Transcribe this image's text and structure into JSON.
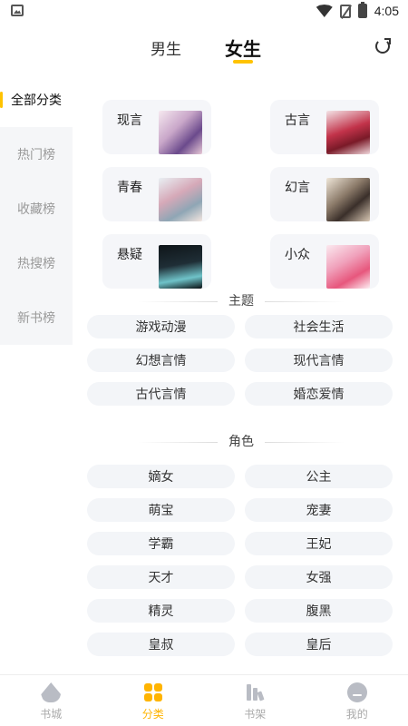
{
  "status_bar": {
    "time": "4:05",
    "icons": [
      "image-icon",
      "wifi-icon",
      "no-sim-icon",
      "battery-icon"
    ]
  },
  "header": {
    "tabs": [
      {
        "label": "男生"
      },
      {
        "label": "女生",
        "active": true
      }
    ],
    "accent_color": "#ffc300"
  },
  "sidebar": {
    "items": [
      {
        "label": "全部分类",
        "active": true
      },
      {
        "label": "热门榜"
      },
      {
        "label": "收藏榜"
      },
      {
        "label": "热搜榜"
      },
      {
        "label": "新书榜"
      }
    ]
  },
  "genres": [
    {
      "label": "现言"
    },
    {
      "label": "古言"
    },
    {
      "label": "青春"
    },
    {
      "label": "幻言"
    },
    {
      "label": "悬疑"
    },
    {
      "label": "小众"
    }
  ],
  "themes": {
    "title": "主题",
    "tags": [
      "游戏动漫",
      "社会生活",
      "幻想言情",
      "现代言情",
      "古代言情",
      "婚恋爱情"
    ]
  },
  "roles": {
    "title": "角色",
    "tags": [
      "嫡女",
      "公主",
      "萌宝",
      "宠妻",
      "学霸",
      "王妃",
      "天才",
      "女强",
      "精灵",
      "腹黑",
      "皇叔",
      "皇后"
    ]
  },
  "bottom_nav": {
    "items": [
      {
        "label": "书城",
        "icon": "home-icon"
      },
      {
        "label": "分类",
        "icon": "category-icon",
        "active": true
      },
      {
        "label": "书架",
        "icon": "bookshelf-icon"
      },
      {
        "label": "我的",
        "icon": "profile-icon"
      }
    ],
    "active_color": "#ffb400"
  }
}
